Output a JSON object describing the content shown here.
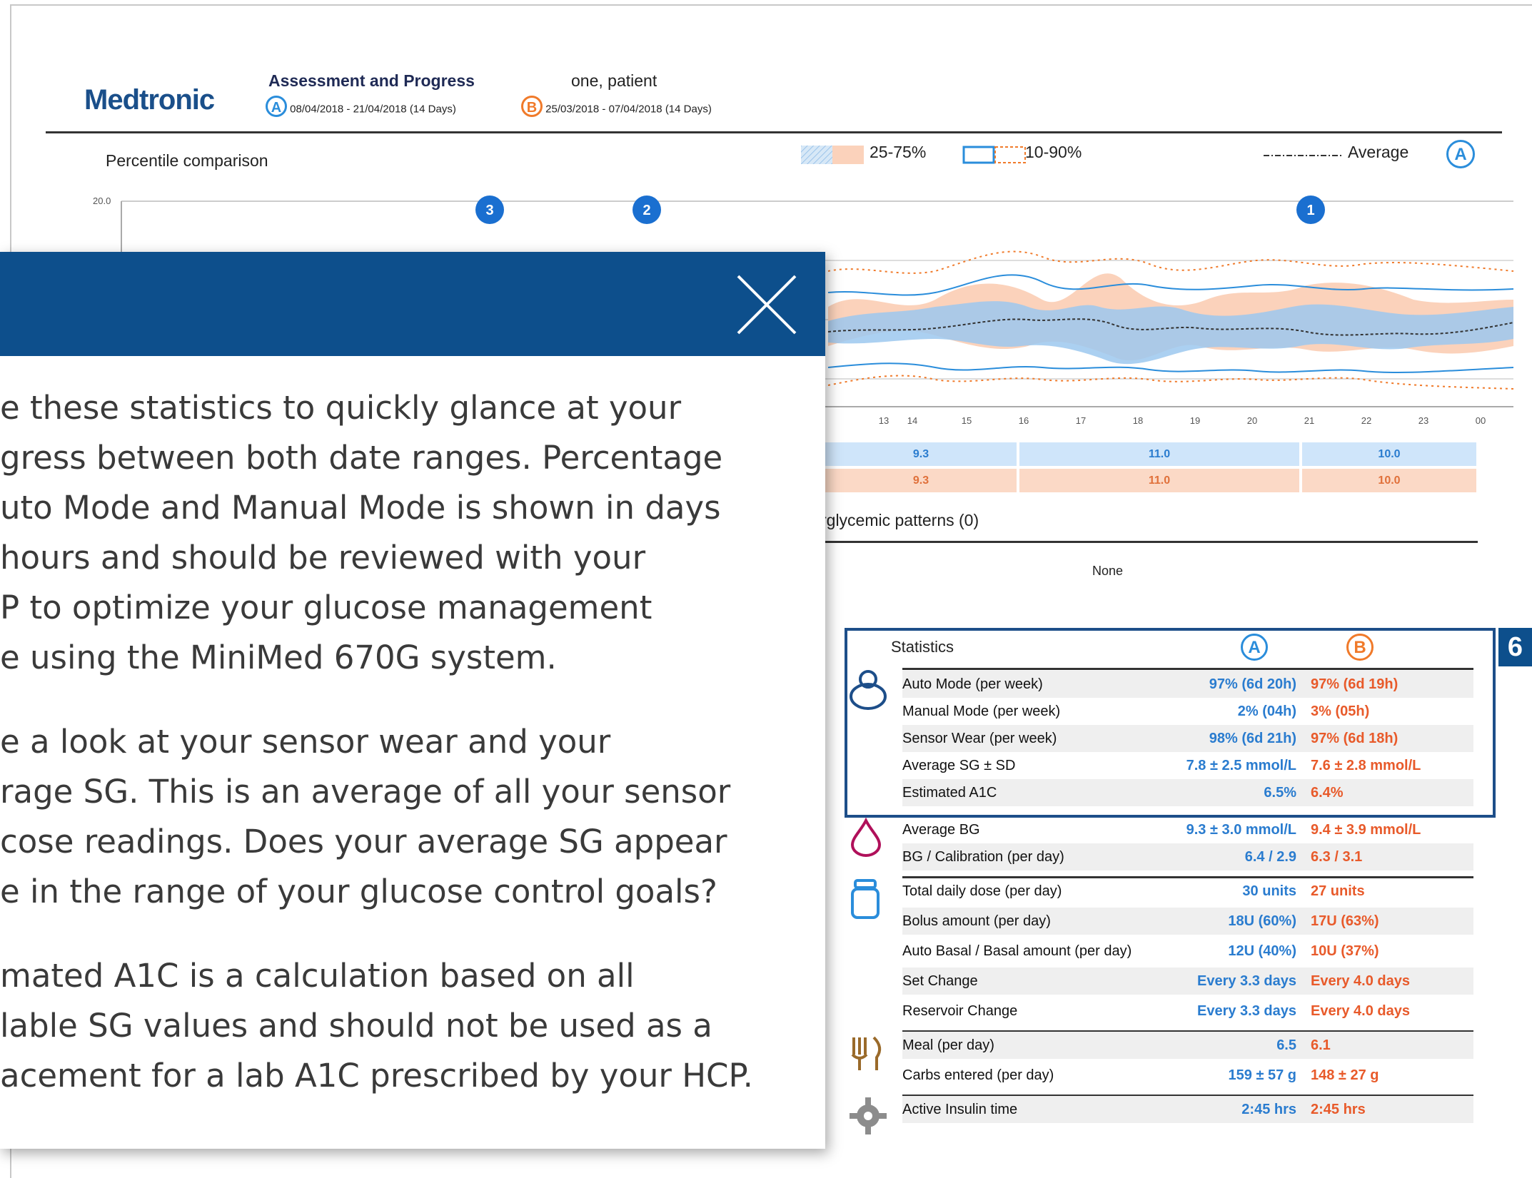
{
  "header": {
    "logo": "Medtronic",
    "title": "Assessment and Progress",
    "patient": "one, patient",
    "range_a_label": "A",
    "range_a": "08/04/2018 - 21/04/2018 (14 Days)",
    "range_b_label": "B",
    "range_b": "25/03/2018 - 07/04/2018 (14 Days)"
  },
  "chart": {
    "title": "Percentile comparison",
    "legend_band": "25-75%",
    "legend_outer": "10-90%",
    "legend_avg": "Average",
    "legend_avg_badge": "A",
    "y_top_label": "20.0",
    "markers": [
      "3",
      "2",
      "1"
    ],
    "x_ticks": [
      "13",
      "14",
      "15",
      "16",
      "17",
      "18",
      "19",
      "20",
      "21",
      "22",
      "23",
      "00"
    ],
    "row_a": [
      "9.3",
      "11.0",
      "10.0"
    ],
    "row_b": [
      "9.3",
      "11.0",
      "10.0"
    ]
  },
  "patterns": {
    "title": "rglycemic patterns (0)",
    "value": "None"
  },
  "statistics": {
    "title": "Statistics",
    "col_a": "A",
    "col_b": "B",
    "badge": "6",
    "rows": [
      {
        "label": "Auto Mode (per week)",
        "a": "97% (6d 20h)",
        "b": "97% (6d 19h)"
      },
      {
        "label": "Manual Mode (per week)",
        "a": "2% (04h)",
        "b": "3% (05h)"
      },
      {
        "label": "Sensor Wear (per week)",
        "a": "98% (6d 21h)",
        "b": "97% (6d 18h)"
      },
      {
        "label": "Average SG ± SD",
        "a": "7.8 ± 2.5 mmol/L",
        "b": "7.6 ± 2.8 mmol/L"
      },
      {
        "label": "Estimated A1C",
        "a": "6.5%",
        "b": "6.4%"
      },
      {
        "label": "Average BG",
        "a": "9.3 ± 3.0 mmol/L",
        "b": "9.4 ± 3.9 mmol/L"
      },
      {
        "label": "BG / Calibration (per day)",
        "a": "6.4 / 2.9",
        "b": "6.3 / 3.1"
      },
      {
        "label": "Total daily dose (per day)",
        "a": "30 units",
        "b": "27 units"
      },
      {
        "label": "Bolus amount (per day)",
        "a": "18U (60%)",
        "b": "17U (63%)"
      },
      {
        "label": "Auto Basal / Basal amount (per day)",
        "a": "12U (40%)",
        "b": "10U (37%)"
      },
      {
        "label": "Set Change",
        "a": "Every 3.3 days",
        "b": "Every 4.0 days"
      },
      {
        "label": "Reservoir Change",
        "a": "Every 3.3 days",
        "b": "Every 4.0 days"
      },
      {
        "label": "Meal (per day)",
        "a": "6.5",
        "b": "6.1"
      },
      {
        "label": "Carbs entered (per day)",
        "a": "159 ± 57 g",
        "b": "148 ± 27 g"
      },
      {
        "label": "Active Insulin time",
        "a": "2:45 hrs",
        "b": "2:45 hrs"
      }
    ]
  },
  "modal": {
    "lines": [
      "e these statistics to quickly glance at your",
      "gress between both date ranges. Percentage",
      "uto Mode and Manual Mode is shown in days",
      " hours and should be reviewed with your",
      "P to optimize your glucose management",
      "e using the MiniMed 670G system.",
      "e a look at your sensor wear and your",
      "rage SG. This is an average of all your sensor",
      "cose readings. Does your average SG appear",
      "e in the range of your glucose control goals?",
      "mated A1C is a calculation based on all",
      "lable SG values and should not be used as a",
      "acement for a lab A1C prescribed by your HCP."
    ]
  },
  "colors": {
    "brand": "#1a4f8a",
    "modal_header": "#0d4f8c",
    "series_a": "#2a8ddb",
    "series_b": "#f07a2a"
  }
}
